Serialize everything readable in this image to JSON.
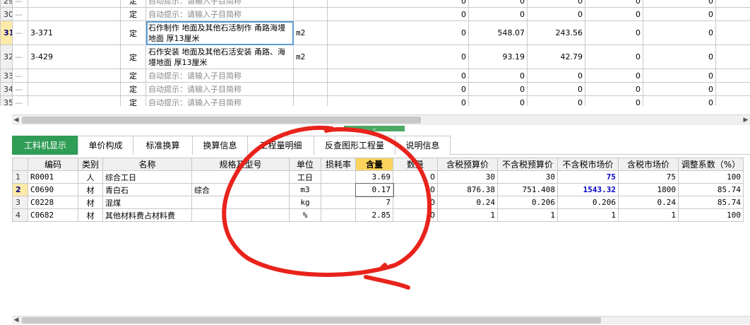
{
  "top_rows": [
    {
      "no": "29",
      "code": "",
      "type": "定",
      "name": "自动提示：请输入子目简称",
      "unit": "",
      "c1": "0",
      "c2": "0",
      "c3": "0",
      "c4": "0",
      "c5": "0",
      "hint": true,
      "partial": true
    },
    {
      "no": "30",
      "code": "",
      "type": "定",
      "name": "自动提示：请输入子目简称",
      "unit": "",
      "c1": "0",
      "c2": "0",
      "c3": "0",
      "c4": "0",
      "c5": "0",
      "hint": true
    },
    {
      "no": "31",
      "code": "3-371",
      "type": "定",
      "name": "石作制作 地面及其他石活制作 甬路海墁地面 厚13厘米",
      "unit": "m2",
      "c1": "0",
      "c2": "548.07",
      "c3": "243.56",
      "c4": "0",
      "c5": "0",
      "active": true
    },
    {
      "no": "32",
      "code": "3-429",
      "type": "定",
      "name": "石作安装 地面及其他石活安装 甬路、海墁地面 厚13厘米",
      "unit": "m2",
      "c1": "0",
      "c2": "93.19",
      "c3": "42.79",
      "c4": "0",
      "c5": "0"
    },
    {
      "no": "33",
      "code": "",
      "type": "定",
      "name": "自动提示：请输入子目简称",
      "unit": "",
      "c1": "0",
      "c2": "0",
      "c3": "0",
      "c4": "0",
      "c5": "0",
      "hint": true
    },
    {
      "no": "34",
      "code": "",
      "type": "定",
      "name": "自动提示：请输入子目简称",
      "unit": "",
      "c1": "0",
      "c2": "0",
      "c3": "0",
      "c4": "0",
      "c5": "0",
      "hint": true
    },
    {
      "no": "35",
      "code": "",
      "type": "定",
      "name": "自动提示：请输入子目简称",
      "unit": "",
      "c1": "0",
      "c2": "0",
      "c3": "0",
      "c4": "0",
      "c5": "0",
      "hint": true
    }
  ],
  "tabs": [
    "工料机显示",
    "单价构成",
    "标准换算",
    "换算信息",
    "工程量明细",
    "反查图形工程量",
    "说明信息"
  ],
  "bottom_headers": [
    "",
    "编码",
    "类别",
    "名称",
    "规格及型号",
    "单位",
    "损耗率",
    "含量",
    "数量",
    "含税预算价",
    "不含税预算价",
    "不含税市场价",
    "含税市场价",
    "调整系数（%）"
  ],
  "bottom_rows": [
    {
      "no": "1",
      "code": "R0001",
      "cat": "人",
      "name": "综合工日",
      "spec": "",
      "unit": "工日",
      "loss": "",
      "qty": "3.69",
      "amount": "0",
      "tax_budget": "30",
      "notax_budget": "30",
      "notax_market": "75",
      "tax_market": "75",
      "factor": "100"
    },
    {
      "no": "2",
      "code": "C0690",
      "cat": "材",
      "name": "青白石",
      "spec": "综合",
      "unit": "m3",
      "loss": "",
      "qty": "0.17",
      "amount": "0",
      "tax_budget": "876.38",
      "notax_budget": "751.408",
      "notax_market": "1543.32",
      "tax_market": "1800",
      "factor": "85.74"
    },
    {
      "no": "3",
      "code": "C0228",
      "cat": "材",
      "name": "混煤",
      "spec": "",
      "unit": "kg",
      "loss": "",
      "qty": "7",
      "amount": "0",
      "tax_budget": "0.24",
      "notax_budget": "0.206",
      "notax_market": "0.206",
      "tax_market": "0.24",
      "factor": "85.74"
    },
    {
      "no": "4",
      "code": "C0682",
      "cat": "材",
      "name": "其他材料费占材料费",
      "spec": "",
      "unit": "%",
      "loss": "",
      "qty": "2.85",
      "amount": "0",
      "tax_budget": "1",
      "notax_budget": "1",
      "notax_market": "1",
      "tax_market": "1",
      "factor": "100"
    }
  ],
  "colors": {
    "tab_active": "#2f9d55",
    "header_highlight": "#fbd35d",
    "annotation": "#e8231c",
    "market_price_blue": "#0000c8"
  },
  "icons": [
    "scroll-left-arrow",
    "scroll-right-arrow",
    "collapse-chevron-icon"
  ]
}
